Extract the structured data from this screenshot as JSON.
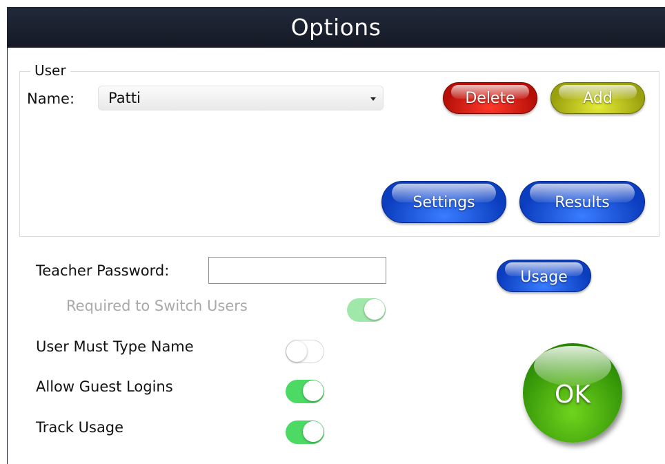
{
  "window": {
    "title": "Options"
  },
  "user_group": {
    "legend": "User",
    "name_label": "Name:",
    "selected_user": "Patti",
    "delete_label": "Delete",
    "add_label": "Add",
    "settings_label": "Settings",
    "results_label": "Results"
  },
  "teacher_password": {
    "label": "Teacher Password:",
    "value": "",
    "usage_label": "Usage"
  },
  "toggles": {
    "required_switch": {
      "label": "Required to Switch Users",
      "on": true,
      "enabled": false
    },
    "must_type_name": {
      "label": "User Must Type Name",
      "on": false
    },
    "allow_guest": {
      "label": "Allow Guest Logins",
      "on": true
    },
    "track_usage": {
      "label": "Track Usage",
      "on": true
    }
  },
  "ok_label": "OK",
  "colors": {
    "titlebar": "#1b2130",
    "toggle_on": "#4cd964",
    "delete": "#c4170e",
    "add": "#b4ba1a",
    "blue_button": "#1547d6",
    "ok": "#3fa50c"
  }
}
